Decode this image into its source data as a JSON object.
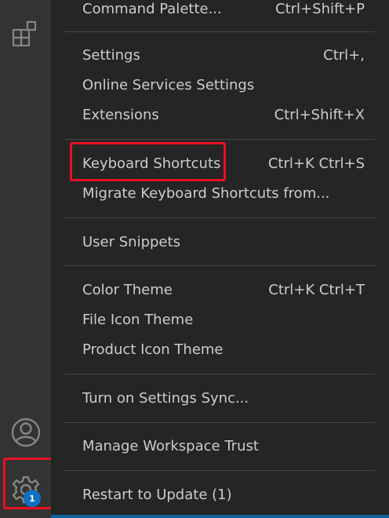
{
  "activity_bar": {
    "icons": [
      "extensions-icon",
      "account-icon",
      "manage-gear-icon"
    ],
    "badge_count": "1",
    "badge_color": "#0e70c0"
  },
  "menu": {
    "items": [
      {
        "label": "Command Palette...",
        "key": "Ctrl+Shift+P"
      },
      {
        "label": "Settings",
        "key": "Ctrl+,"
      },
      {
        "label": "Online Services Settings",
        "key": ""
      },
      {
        "label": "Extensions",
        "key": "Ctrl+Shift+X"
      },
      {
        "label": "Keyboard Shortcuts",
        "key": "Ctrl+K Ctrl+S"
      },
      {
        "label": "Migrate Keyboard Shortcuts from...",
        "key": ""
      },
      {
        "label": "User Snippets",
        "key": ""
      },
      {
        "label": "Color Theme",
        "key": "Ctrl+K Ctrl+T"
      },
      {
        "label": "File Icon Theme",
        "key": ""
      },
      {
        "label": "Product Icon Theme",
        "key": ""
      },
      {
        "label": "Turn on Settings Sync...",
        "key": ""
      },
      {
        "label": "Manage Workspace Trust",
        "key": ""
      },
      {
        "label": "Restart to Update (1)",
        "key": ""
      }
    ]
  },
  "colors": {
    "highlight": "#e81123",
    "menu_bg": "#252526",
    "activity_bar_bg": "#333333",
    "text": "#cccccc"
  }
}
